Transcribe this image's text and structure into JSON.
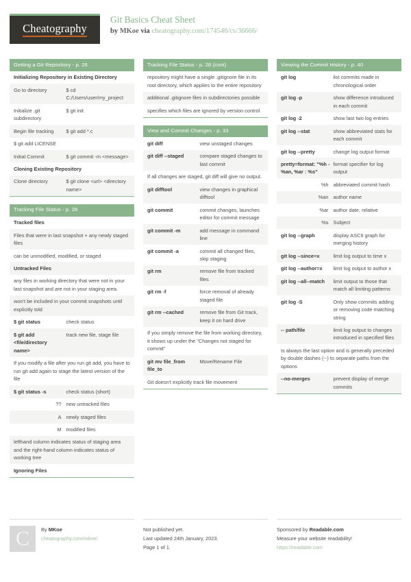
{
  "header": {
    "logo_text": "Cheatography",
    "title": "Git Basics Cheat Sheet",
    "by_label": "by",
    "author": "MKoe",
    "via_label": "via",
    "source_url": "cheatography.com/174546/cs/36666/"
  },
  "columns": [
    {
      "blocks": [
        {
          "title": "Getting a Git Repository - p. 26",
          "rows": [
            {
              "type": "sub",
              "text": "Initializing Repository in Existing Directory"
            },
            {
              "type": "kv",
              "k": "Go to directory",
              "v": "$ cd C:/Users/user/my_project"
            },
            {
              "type": "kv",
              "k": "Initialize .git subdirectory",
              "v": "$ git init"
            },
            {
              "type": "kv",
              "k": "Begin file tracking",
              "v": "$ git add *.c"
            },
            {
              "type": "kv",
              "k": "$ git add LICENSE",
              "v": ""
            },
            {
              "type": "kv",
              "k": "Initial Commit",
              "v": "$ git commit -m <message>"
            },
            {
              "type": "sub",
              "text": "Cloning Existing Repository"
            },
            {
              "type": "kv",
              "k": "Clone directory",
              "v": "$ git clone <url> <directory name>"
            }
          ]
        },
        {
          "title": "Tracking File Status - p. 28",
          "rows": [
            {
              "type": "sub",
              "text": "Tracked files"
            },
            {
              "type": "plain",
              "text": "Files that were in last snapshot + any newly staged files"
            },
            {
              "type": "plain",
              "text": "can be unmodified, modified, or staged"
            },
            {
              "type": "sub",
              "text": "Untracked Files"
            },
            {
              "type": "plain",
              "text": "any files in working directory that were not in your last snapshot and are not in your staging area."
            },
            {
              "type": "plain",
              "text": "won't be included in your commit snapshots until explicitly told"
            },
            {
              "type": "kv",
              "k": "$ git status",
              "kbold": true,
              "v": "check status"
            },
            {
              "type": "kv",
              "k": "$ git add <file/directory name>",
              "kbold": true,
              "v": "track new file, stage file"
            },
            {
              "type": "plain",
              "text": "If you modify a file after you run git add, you have to run git add again to stage the latest version of the file"
            },
            {
              "type": "kv",
              "k": "$ git status -s",
              "kbold": true,
              "v": "check status (short)"
            },
            {
              "type": "kv",
              "k": "??",
              "kright": true,
              "v": "new untracked files"
            },
            {
              "type": "kv",
              "k": "A",
              "kright": true,
              "v": "newly staged files"
            },
            {
              "type": "kv",
              "k": "M",
              "kright": true,
              "v": "modified files"
            },
            {
              "type": "plain",
              "text": "lefthand column indicates status of staging area and the right-hand column indicates status of working tree"
            },
            {
              "type": "sub",
              "text": "Ignoring Files"
            }
          ]
        }
      ]
    },
    {
      "blocks": [
        {
          "title": "Tracking File Status - p. 28 (cont)",
          "rows": [
            {
              "type": "plain",
              "text": "repository might have a single .gitignore file in its root directory, which applies to the entire repository"
            },
            {
              "type": "plain",
              "text": "additional .gitignore files in subdirectories possible"
            },
            {
              "type": "plain",
              "text": "specifies which files are ignored by version control"
            }
          ]
        },
        {
          "title": "View and Commit Changes - p. 33",
          "rows": [
            {
              "type": "kv",
              "k": "git diff",
              "kbold": true,
              "v": "view unstaged changes"
            },
            {
              "type": "kv",
              "k": "git diff --staged",
              "kbold": true,
              "v": "compare staged changes to last commit"
            },
            {
              "type": "plain",
              "text": "If all changes are staged, git diff will give no output."
            },
            {
              "type": "kv",
              "k": "git difftool",
              "kbold": true,
              "v": "view changes in graphical difftool"
            },
            {
              "type": "kv",
              "k": "git commit",
              "kbold": true,
              "v": "commit changes, launches editor for commit message"
            },
            {
              "type": "kv",
              "k": "git commit -m",
              "kbold": true,
              "v": "add message in command line"
            },
            {
              "type": "kv",
              "k": "git commit -a",
              "kbold": true,
              "v": "commit all changed files, skip staging"
            },
            {
              "type": "kv",
              "k": "git rm",
              "kbold": true,
              "v": "remove file from tracked files"
            },
            {
              "type": "kv",
              "k": "git rm -f",
              "kbold": true,
              "v": "force removal of already staged file"
            },
            {
              "type": "kv",
              "k": "git rm --cached",
              "kbold": true,
              "v": "remove file from Git track, keep it on hard drive"
            },
            {
              "type": "plain",
              "text": "If you simply remove the file from working directory, it shows up under the \"Changes not staged for commit\""
            },
            {
              "type": "kv",
              "k": "git mv file_from file_to",
              "kbold": true,
              "v": "Move/Rename File"
            },
            {
              "type": "plain",
              "text": "Git doesn't explicitly track file movement"
            }
          ]
        }
      ]
    },
    {
      "blocks": [
        {
          "title": "Viewing the Commit History - p. 40",
          "rows": [
            {
              "type": "kv",
              "k": "git log",
              "kbold": true,
              "v": "list commits made in chronological order"
            },
            {
              "type": "kv",
              "k": "git log -p",
              "kbold": true,
              "v": "show difference introduced in each commit"
            },
            {
              "type": "kv",
              "k": "git log -2",
              "kbold": true,
              "v": "show last two log entries"
            },
            {
              "type": "kv",
              "k": "git log --stat",
              "kbold": true,
              "v": "show abbreviated stats for each commit"
            },
            {
              "type": "kv",
              "k": "git log --pretty",
              "kbold": true,
              "v": "change log output format"
            },
            {
              "type": "kv",
              "k": "pretty=format: \"%h - %an, %ar : %s\"",
              "kbold": true,
              "v": "format specifier for log output"
            },
            {
              "type": "kv",
              "k": "%h",
              "kright": true,
              "v": "abbreviated commit hash"
            },
            {
              "type": "kv",
              "k": "%an",
              "kright": true,
              "v": "author name"
            },
            {
              "type": "kv",
              "k": "%ar",
              "kright": true,
              "v": "author date, relative"
            },
            {
              "type": "kv",
              "k": "%s",
              "kright": true,
              "v": "Subject"
            },
            {
              "type": "kv",
              "k": "git log --graph",
              "kbold": true,
              "v": "display ASCII graph for merging history"
            },
            {
              "type": "kv",
              "k": "git log --since=x",
              "kbold": true,
              "v": "limit log output to time x"
            },
            {
              "type": "kv",
              "k": "git log --author=x",
              "kbold": true,
              "v": "limit log output to author x"
            },
            {
              "type": "kv",
              "k": "git log --all--match",
              "kbold": true,
              "v": "limit output to those that match all limiting patterns"
            },
            {
              "type": "kv",
              "k": "git log -S",
              "kbold": true,
              "v": "Only show commits adding or removing code matching string"
            },
            {
              "type": "kv",
              "k": "-- path/file",
              "kbold": true,
              "v": "limit log output to changes introduced in specified files"
            },
            {
              "type": "plain",
              "text": "Is always the last option and is generally preceded by double dashes (--) to separate paths from the options"
            },
            {
              "type": "kv",
              "k": "--no-merges",
              "kbold": true,
              "v": "prevent display of merge commits"
            }
          ]
        }
      ]
    }
  ],
  "footer": {
    "avatar_letter": "C",
    "by_label": "By",
    "author": "MKoe",
    "author_url": "cheatography.com/mkoe/",
    "publish_status": "Not published yet.",
    "last_updated": "Last updated 24th January, 2023.",
    "page_info": "Page 1 of 1.",
    "sponsor_prefix": "Sponsored by",
    "sponsor_name": "Readable.com",
    "sponsor_tagline": "Measure your website readability!",
    "sponsor_url": "https://readable.com"
  },
  "colors": {
    "accent_green": "#8ab48b",
    "logo_dark": "#36342f",
    "logo_underline": "#c8651b",
    "row_alt": "#f4f4f2"
  }
}
